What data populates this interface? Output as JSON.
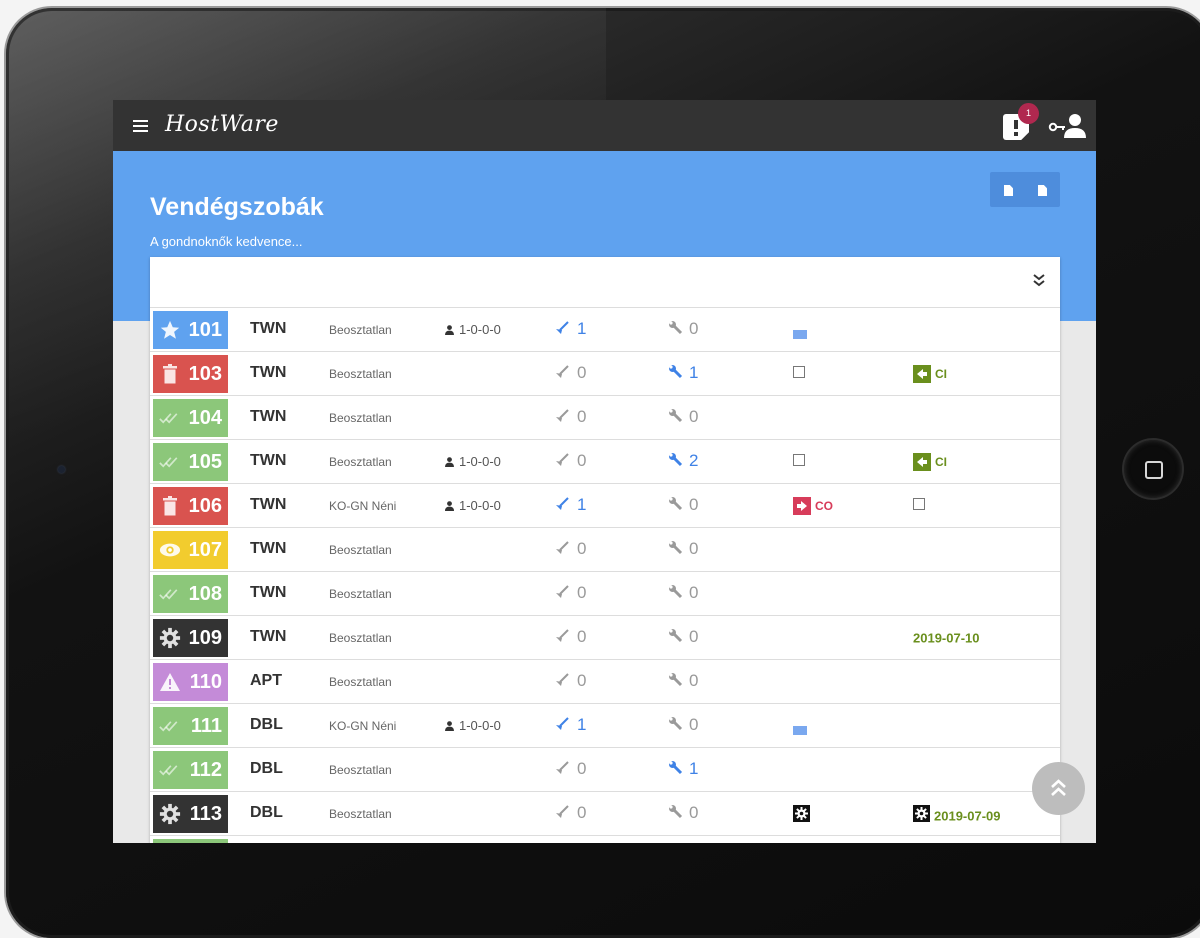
{
  "app": {
    "logo": "HostWare",
    "notification_count": "1"
  },
  "page": {
    "title": "Vendégszobák",
    "subtitle": "A gondnoknők kedvence..."
  },
  "colors": {
    "header": "#5fa2ef",
    "topbar": "#333333",
    "status_clean": "#8cc77a",
    "status_dirty": "#d9534f",
    "status_priority": "#5fa2ef",
    "status_inspect": "#f2cc2e",
    "status_maint": "#333333",
    "status_warn": "#c48bd8",
    "active_blue": "#3f82e6",
    "inactive_gray": "#9a9a9a",
    "ci_green": "#6a8f1d",
    "co_red": "#d73c5a"
  },
  "rooms": [
    {
      "number": "101",
      "status": "priority",
      "status_icon": "star-icon",
      "type": "TWN",
      "assignee": "Beosztatlan",
      "guests": "1-0-0-0",
      "cleaning": "1",
      "cleaning_active": true,
      "maintenance": "0",
      "maintenance_active": false,
      "col7": "bed",
      "col8": ""
    },
    {
      "number": "103",
      "status": "dirty",
      "status_icon": "trash-icon",
      "type": "TWN",
      "assignee": "Beosztatlan",
      "guests": "",
      "cleaning": "0",
      "cleaning_active": false,
      "maintenance": "1",
      "maintenance_active": true,
      "col7": "checkbox",
      "col8": "CI"
    },
    {
      "number": "104",
      "status": "clean",
      "status_icon": "check-icon",
      "type": "TWN",
      "assignee": "Beosztatlan",
      "guests": "",
      "cleaning": "0",
      "cleaning_active": false,
      "maintenance": "0",
      "maintenance_active": false,
      "col7": "",
      "col8": ""
    },
    {
      "number": "105",
      "status": "clean",
      "status_icon": "check-icon",
      "type": "TWN",
      "assignee": "Beosztatlan",
      "guests": "1-0-0-0",
      "cleaning": "0",
      "cleaning_active": false,
      "maintenance": "2",
      "maintenance_active": true,
      "col7": "checkbox",
      "col8": "CI"
    },
    {
      "number": "106",
      "status": "dirty",
      "status_icon": "trash-icon",
      "type": "TWN",
      "assignee": "KO-GN Néni",
      "guests": "1-0-0-0",
      "cleaning": "1",
      "cleaning_active": true,
      "maintenance": "0",
      "maintenance_active": false,
      "col7": "CO",
      "col8": "checkbox"
    },
    {
      "number": "107",
      "status": "inspect",
      "status_icon": "eye-icon",
      "type": "TWN",
      "assignee": "Beosztatlan",
      "guests": "",
      "cleaning": "0",
      "cleaning_active": false,
      "maintenance": "0",
      "maintenance_active": false,
      "col7": "",
      "col8": ""
    },
    {
      "number": "108",
      "status": "clean",
      "status_icon": "check-icon",
      "type": "TWN",
      "assignee": "Beosztatlan",
      "guests": "",
      "cleaning": "0",
      "cleaning_active": false,
      "maintenance": "0",
      "maintenance_active": false,
      "col7": "",
      "col8": ""
    },
    {
      "number": "109",
      "status": "maint",
      "status_icon": "gear-icon",
      "type": "TWN",
      "assignee": "Beosztatlan",
      "guests": "",
      "cleaning": "0",
      "cleaning_active": false,
      "maintenance": "0",
      "maintenance_active": false,
      "col7": "",
      "col8": "2019-07-10"
    },
    {
      "number": "110",
      "status": "warn",
      "status_icon": "warning-icon",
      "type": "APT",
      "assignee": "Beosztatlan",
      "guests": "",
      "cleaning": "0",
      "cleaning_active": false,
      "maintenance": "0",
      "maintenance_active": false,
      "col7": "",
      "col8": ""
    },
    {
      "number": "111",
      "status": "clean",
      "status_icon": "check-icon",
      "type": "DBL",
      "assignee": "KO-GN Néni",
      "guests": "1-0-0-0",
      "cleaning": "1",
      "cleaning_active": true,
      "maintenance": "0",
      "maintenance_active": false,
      "col7": "bed",
      "col8": ""
    },
    {
      "number": "112",
      "status": "clean",
      "status_icon": "check-icon",
      "type": "DBL",
      "assignee": "Beosztatlan",
      "guests": "",
      "cleaning": "0",
      "cleaning_active": false,
      "maintenance": "1",
      "maintenance_active": true,
      "col7": "",
      "col8": ""
    },
    {
      "number": "113",
      "status": "maint",
      "status_icon": "gear-icon",
      "type": "DBL",
      "assignee": "Beosztatlan",
      "guests": "",
      "cleaning": "0",
      "cleaning_active": false,
      "maintenance": "0",
      "maintenance_active": false,
      "col7": "gear",
      "col8": "2019-07-09"
    },
    {
      "number": "",
      "status": "clean",
      "status_icon": "check-icon",
      "type": "",
      "assignee": "",
      "guests": "",
      "cleaning": "",
      "cleaning_active": false,
      "maintenance": "",
      "maintenance_active": false,
      "col7": "",
      "col8": ""
    }
  ]
}
